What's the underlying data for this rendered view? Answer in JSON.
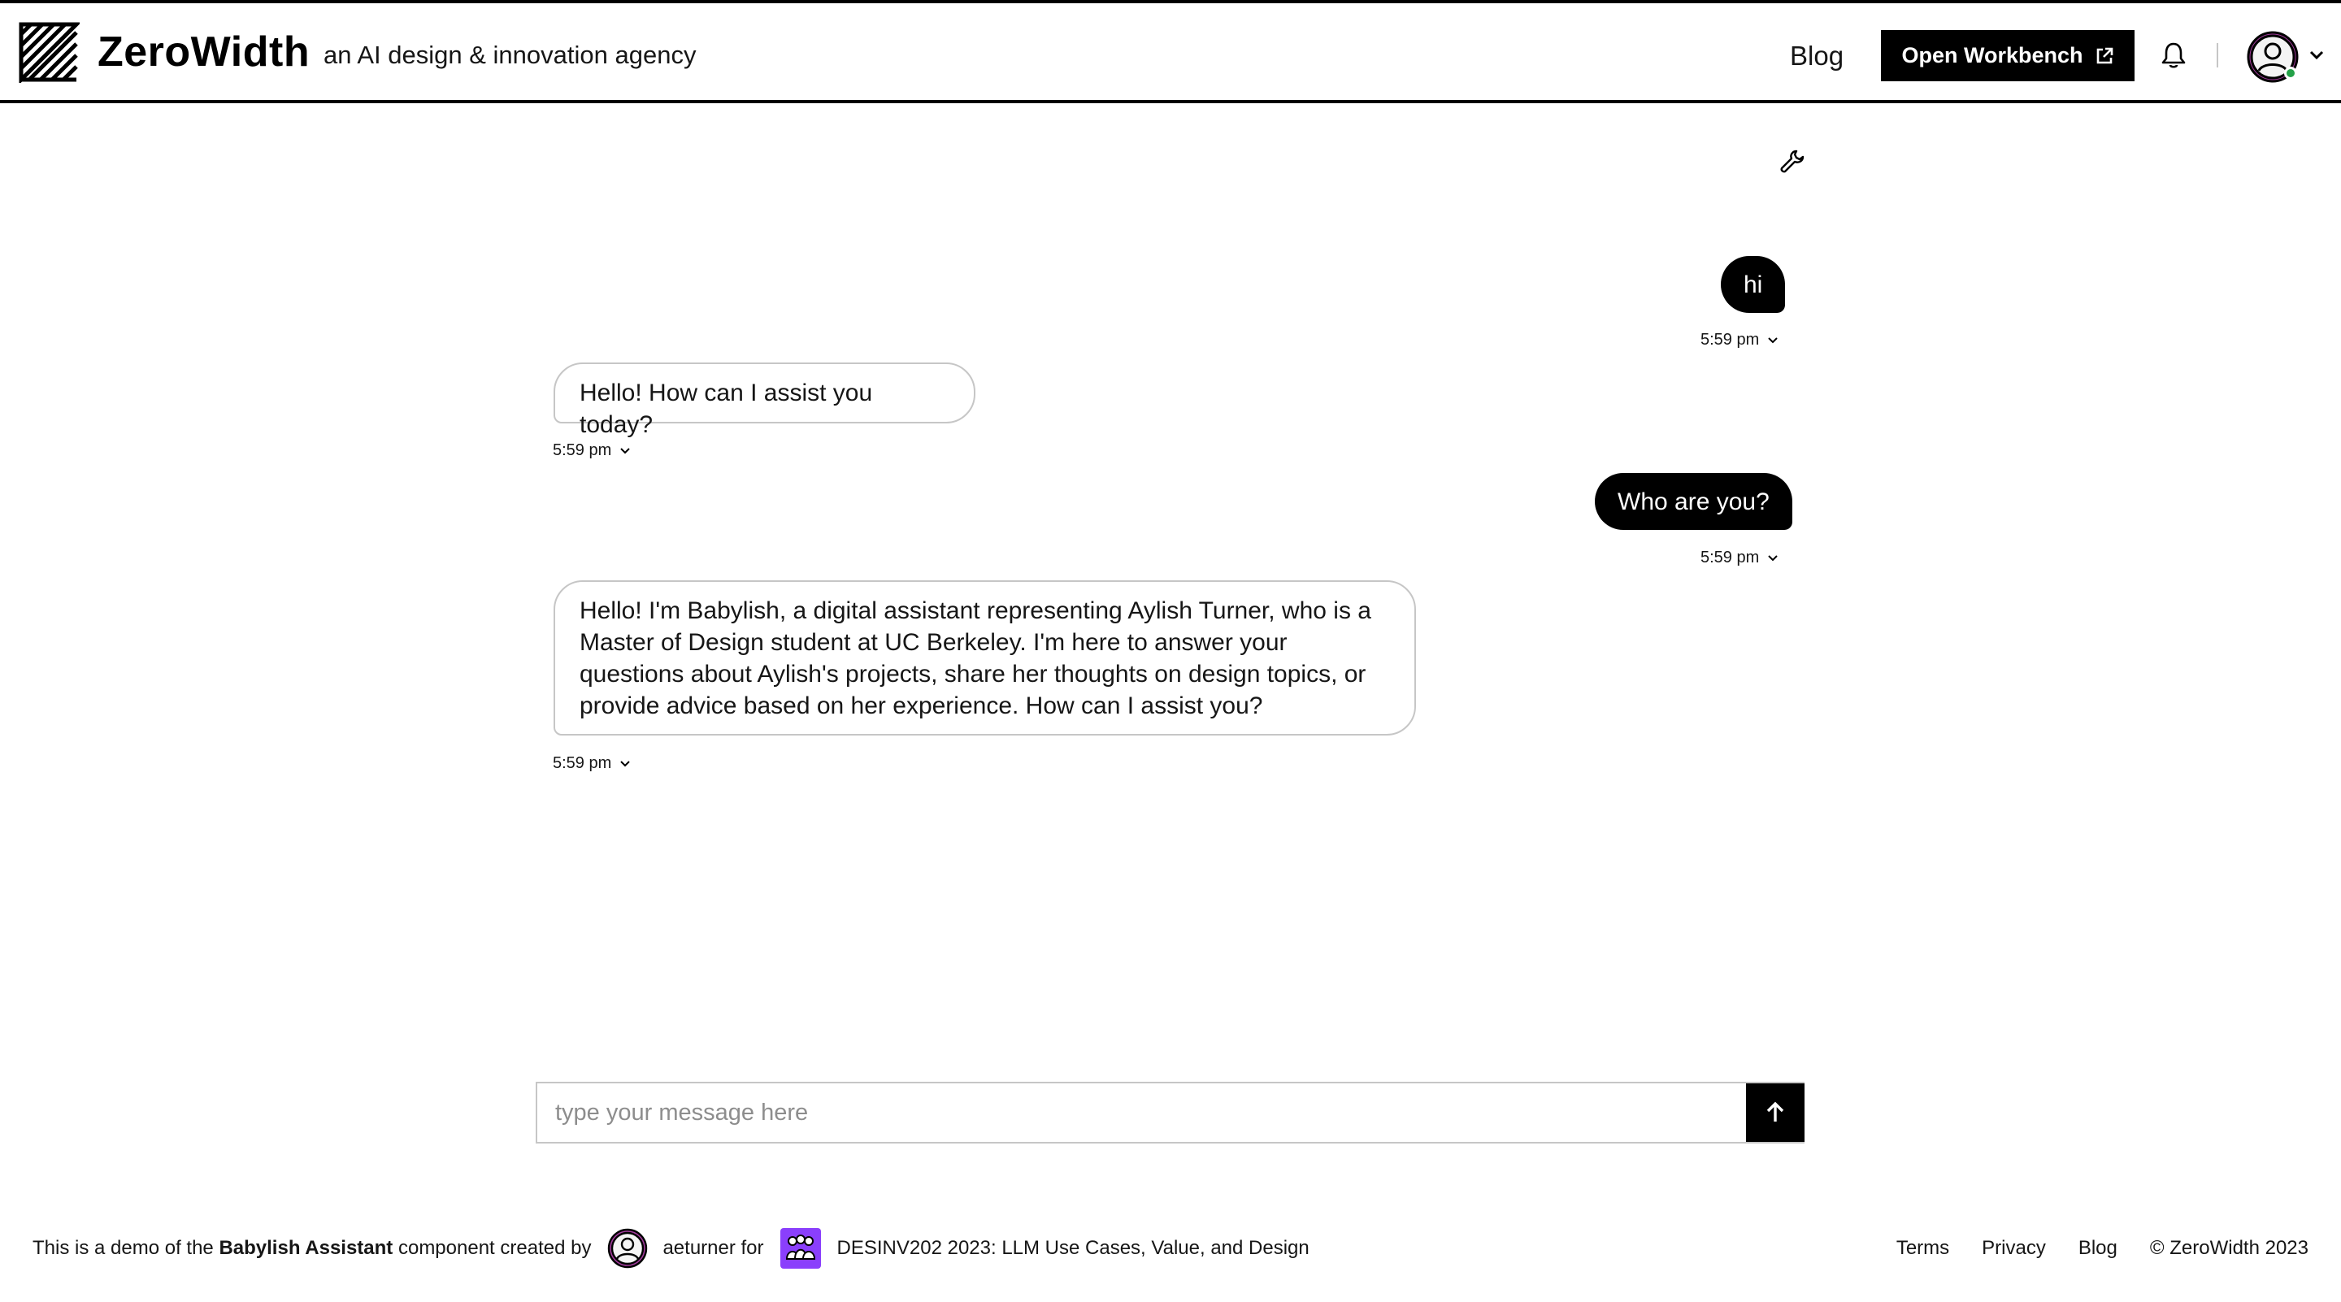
{
  "header": {
    "brand": "ZeroWidth",
    "tagline": "an AI design & innovation agency",
    "nav_blog": "Blog",
    "workbench_label": "Open Workbench"
  },
  "chat": {
    "messages": [
      {
        "role": "user",
        "text": "hi",
        "time": "5:59 pm"
      },
      {
        "role": "assistant",
        "text": "Hello! How can I assist you today?",
        "time": "5:59 pm"
      },
      {
        "role": "user",
        "text": "Who are you?",
        "time": "5:59 pm"
      },
      {
        "role": "assistant",
        "lines": [
          "Hello! I'm Babylish, a digital assistant representing Aylish Turner, who is a",
          "Master of Design student at UC Berkeley. I'm here to answer your",
          "questions about Aylish's projects, share her thoughts on design topics, or",
          "provide advice based on her experience. How can I assist you?"
        ],
        "time": "5:59 pm"
      }
    ]
  },
  "composer": {
    "placeholder": "type your message here"
  },
  "footer": {
    "demo_prefix": "This is a demo of the",
    "component_name": "Babylish Assistant",
    "created_by": "component created by",
    "username": "aeturner for",
    "project": "DESINV202 2023: LLM Use Cases, Value, and Design",
    "links": [
      "Terms",
      "Privacy",
      "Blog"
    ],
    "copyright": "© ZeroWidth 2023"
  },
  "colors": {
    "accent_avatar": "#a13a9b",
    "team_badge": "#8a3ffc",
    "online_status": "#24a148"
  },
  "icons": [
    "zerowidth-logo-icon",
    "external-link-icon",
    "bell-icon",
    "user-avatar-icon",
    "chevron-down-icon",
    "wrench-icon",
    "arrow-up-icon",
    "team-icon"
  ]
}
